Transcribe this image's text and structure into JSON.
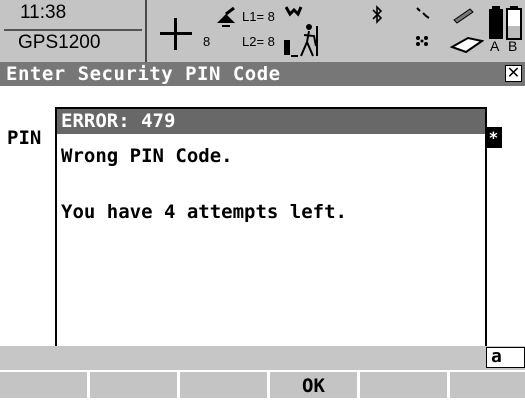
{
  "status": {
    "time": "11:38",
    "instrument": "GPS1200",
    "sat_count": "8",
    "l1": "L1= 8",
    "l2": "L2= 8",
    "batt_a": "A",
    "batt_b": "B",
    "icons": [
      "position-crosshair-icon",
      "satellite-dish-icon",
      "antenna-icon",
      "surveyor-pole-icon",
      "bluetooth-icon",
      "radio-link-icon",
      "modem-icon",
      "pen-icon",
      "memory-card-icon",
      "battery-icon"
    ]
  },
  "title": {
    "text": "Enter Security PIN Code",
    "close_glyph": "✕"
  },
  "form": {
    "pin_label": "PIN",
    "pin_value": "*"
  },
  "dialog": {
    "title": "ERROR: 479",
    "line1": "Wrong PIN Code.",
    "line2": "You have 4 attempts left."
  },
  "input_mode": "a",
  "softkeys": [
    "",
    "",
    "",
    "OK",
    "",
    ""
  ]
}
